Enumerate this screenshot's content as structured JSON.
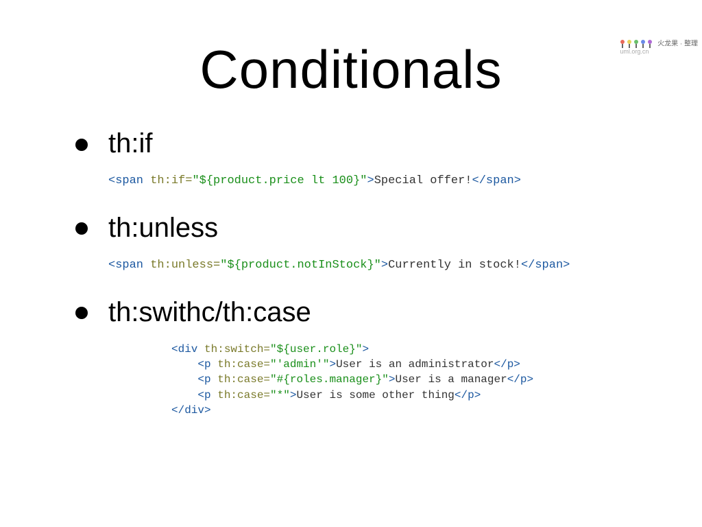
{
  "watermark": {
    "line1": "火龙果 · 整理",
    "line2": "uml.org.cn"
  },
  "title": "Conditionals",
  "bullets": {
    "b1": "th:if",
    "b2": "th:unless",
    "b3": "th:swithc/th:case"
  },
  "code1": {
    "open1": "<span",
    "attr": " th:if",
    "eq": "=",
    "str": "\"${product.price lt 100}\"",
    "close1": ">",
    "text": "Special offer!",
    "close2": "</span>"
  },
  "code2": {
    "open1": "<span",
    "attr": " th:unless",
    "eq": "=",
    "str": "\"${product.notInStock}\"",
    "close1": ">",
    "text": "Currently in stock!",
    "close2": "</span>"
  },
  "code3": {
    "l1_open": "<div",
    "l1_attr": " th:switch",
    "l1_eq": "=",
    "l1_str": "\"${user.role}\"",
    "l1_close": ">",
    "l2_open": "<p",
    "l2_attr": " th:case",
    "l2_eq": "=",
    "l2_str": "\"'admin'\"",
    "l2_close": ">",
    "l2_text": "User is an administrator",
    "l2_end": "</p>",
    "l3_open": "<p",
    "l3_attr": " th:case",
    "l3_eq": "=",
    "l3_str": "\"#{roles.manager}\"",
    "l3_close": ">",
    "l3_text": "User is a manager",
    "l3_end": "</p>",
    "l4_open": "<p",
    "l4_attr": " th:case",
    "l4_eq": "=",
    "l4_str": "\"*\"",
    "l4_close": ">",
    "l4_text": "User is some other thing",
    "l4_end": "</p>",
    "l5": "</div>"
  }
}
